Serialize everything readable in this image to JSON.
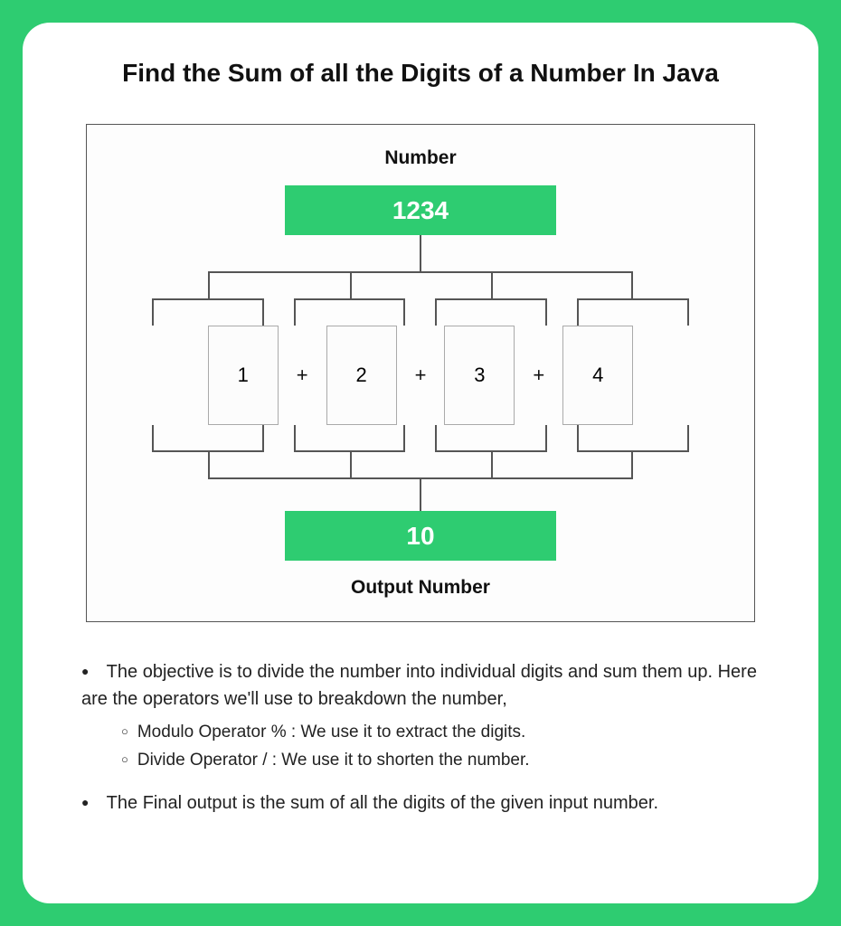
{
  "title": "Find the Sum of all the Digits of a Number In Java",
  "diagram": {
    "top_label": "Number",
    "input_value": "1234",
    "digits": [
      "1",
      "2",
      "3",
      "4"
    ],
    "operator": "+",
    "output_value": "10",
    "bottom_label": "Output Number"
  },
  "bullets": [
    {
      "text": "The objective is to divide the number into individual digits and sum them up. Here are the operators we'll use to breakdown the number,",
      "sub": [
        "Modulo Operator % : We use it to extract the digits.",
        "Divide Operator / : We use it to shorten the number."
      ]
    },
    {
      "text": "The Final output is the sum of all the digits of the given input number.",
      "sub": []
    }
  ]
}
